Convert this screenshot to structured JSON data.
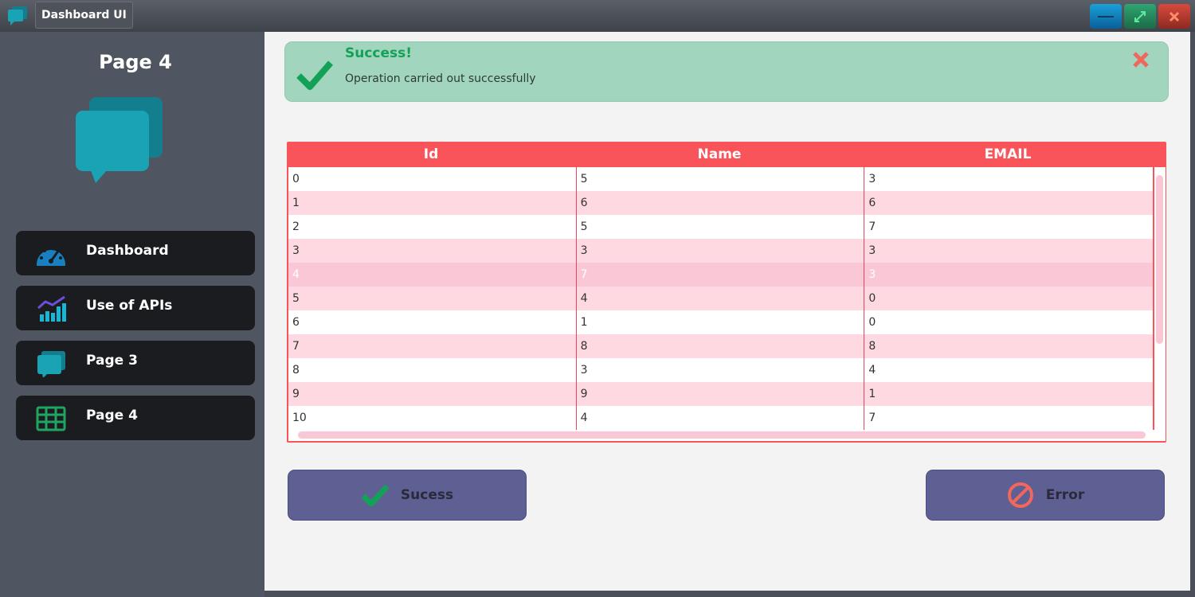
{
  "window": {
    "title": "Dashboard UI",
    "accent": "#19a3b5"
  },
  "sidebar": {
    "heading": "Page 4",
    "items": [
      {
        "label": "Dashboard",
        "icon": "speedometer-icon"
      },
      {
        "label": "Use of APIs",
        "icon": "chart-icon"
      },
      {
        "label": "Page 3",
        "icon": "chat-icon"
      },
      {
        "label": "Page 4",
        "icon": "table-icon"
      }
    ]
  },
  "alert": {
    "title": "Success!",
    "message": "Operation carried out successfully",
    "color": "#a2d5be"
  },
  "table": {
    "columns": [
      "Id",
      "Name",
      "EMAIL"
    ],
    "rows": [
      [
        "0",
        "5",
        "3"
      ],
      [
        "1",
        "6",
        "6"
      ],
      [
        "2",
        "5",
        "7"
      ],
      [
        "3",
        "3",
        "3"
      ],
      [
        "4",
        "7",
        "3"
      ],
      [
        "5",
        "4",
        "0"
      ],
      [
        "6",
        "1",
        "0"
      ],
      [
        "7",
        "8",
        "8"
      ],
      [
        "8",
        "3",
        "4"
      ],
      [
        "9",
        "9",
        "1"
      ],
      [
        "10",
        "4",
        "7"
      ]
    ],
    "selected_row": 4,
    "header_color": "#f9545a"
  },
  "buttons": {
    "success_label": "Sucess",
    "error_label": "Error"
  }
}
